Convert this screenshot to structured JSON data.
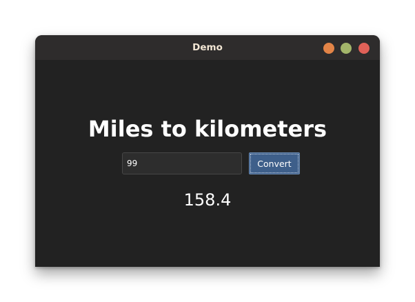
{
  "window": {
    "title": "Demo",
    "controls": {
      "minimize_color": "#e38447",
      "maximize_color": "#a3b56a",
      "close_color": "#e06158"
    }
  },
  "main": {
    "heading": "Miles to kilometers",
    "miles_input": {
      "value": "99",
      "placeholder": ""
    },
    "convert_label": "Convert",
    "result": "158.4"
  },
  "colors": {
    "window_bg": "#222222",
    "titlebar_bg": "#2e2c2c",
    "button_bg": "#3e5f8a",
    "text": "#ffffff"
  }
}
